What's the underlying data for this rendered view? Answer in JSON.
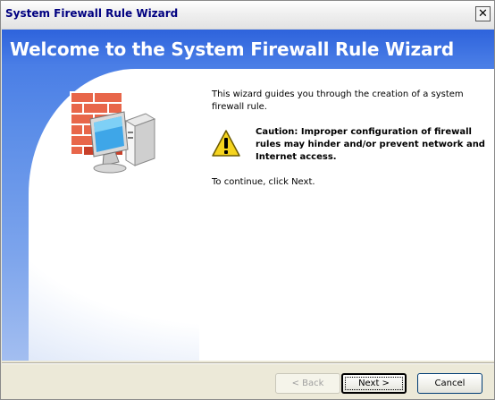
{
  "window": {
    "title": "System Firewall Rule Wizard"
  },
  "banner": {
    "heading": "Welcome to the System Firewall Rule Wizard"
  },
  "content": {
    "intro": "This wizard guides you through the creation of a system firewall rule.",
    "caution": "Caution: Improper configuration of firewall rules may hinder and/or prevent network and Internet access.",
    "continue": "To continue, click Next."
  },
  "buttons": {
    "back": "< Back",
    "next": "Next >",
    "cancel": "Cancel"
  },
  "icons": {
    "titlebar_close": "close-icon",
    "warning": "warning-icon",
    "firewall": "firewall-computer-icon"
  },
  "colors": {
    "banner_top": "#2e63dc",
    "banner_bottom": "#a3bef0",
    "title_text": "#000080",
    "window_bg": "#ece9d8",
    "warning_yellow": "#f6d41e"
  }
}
